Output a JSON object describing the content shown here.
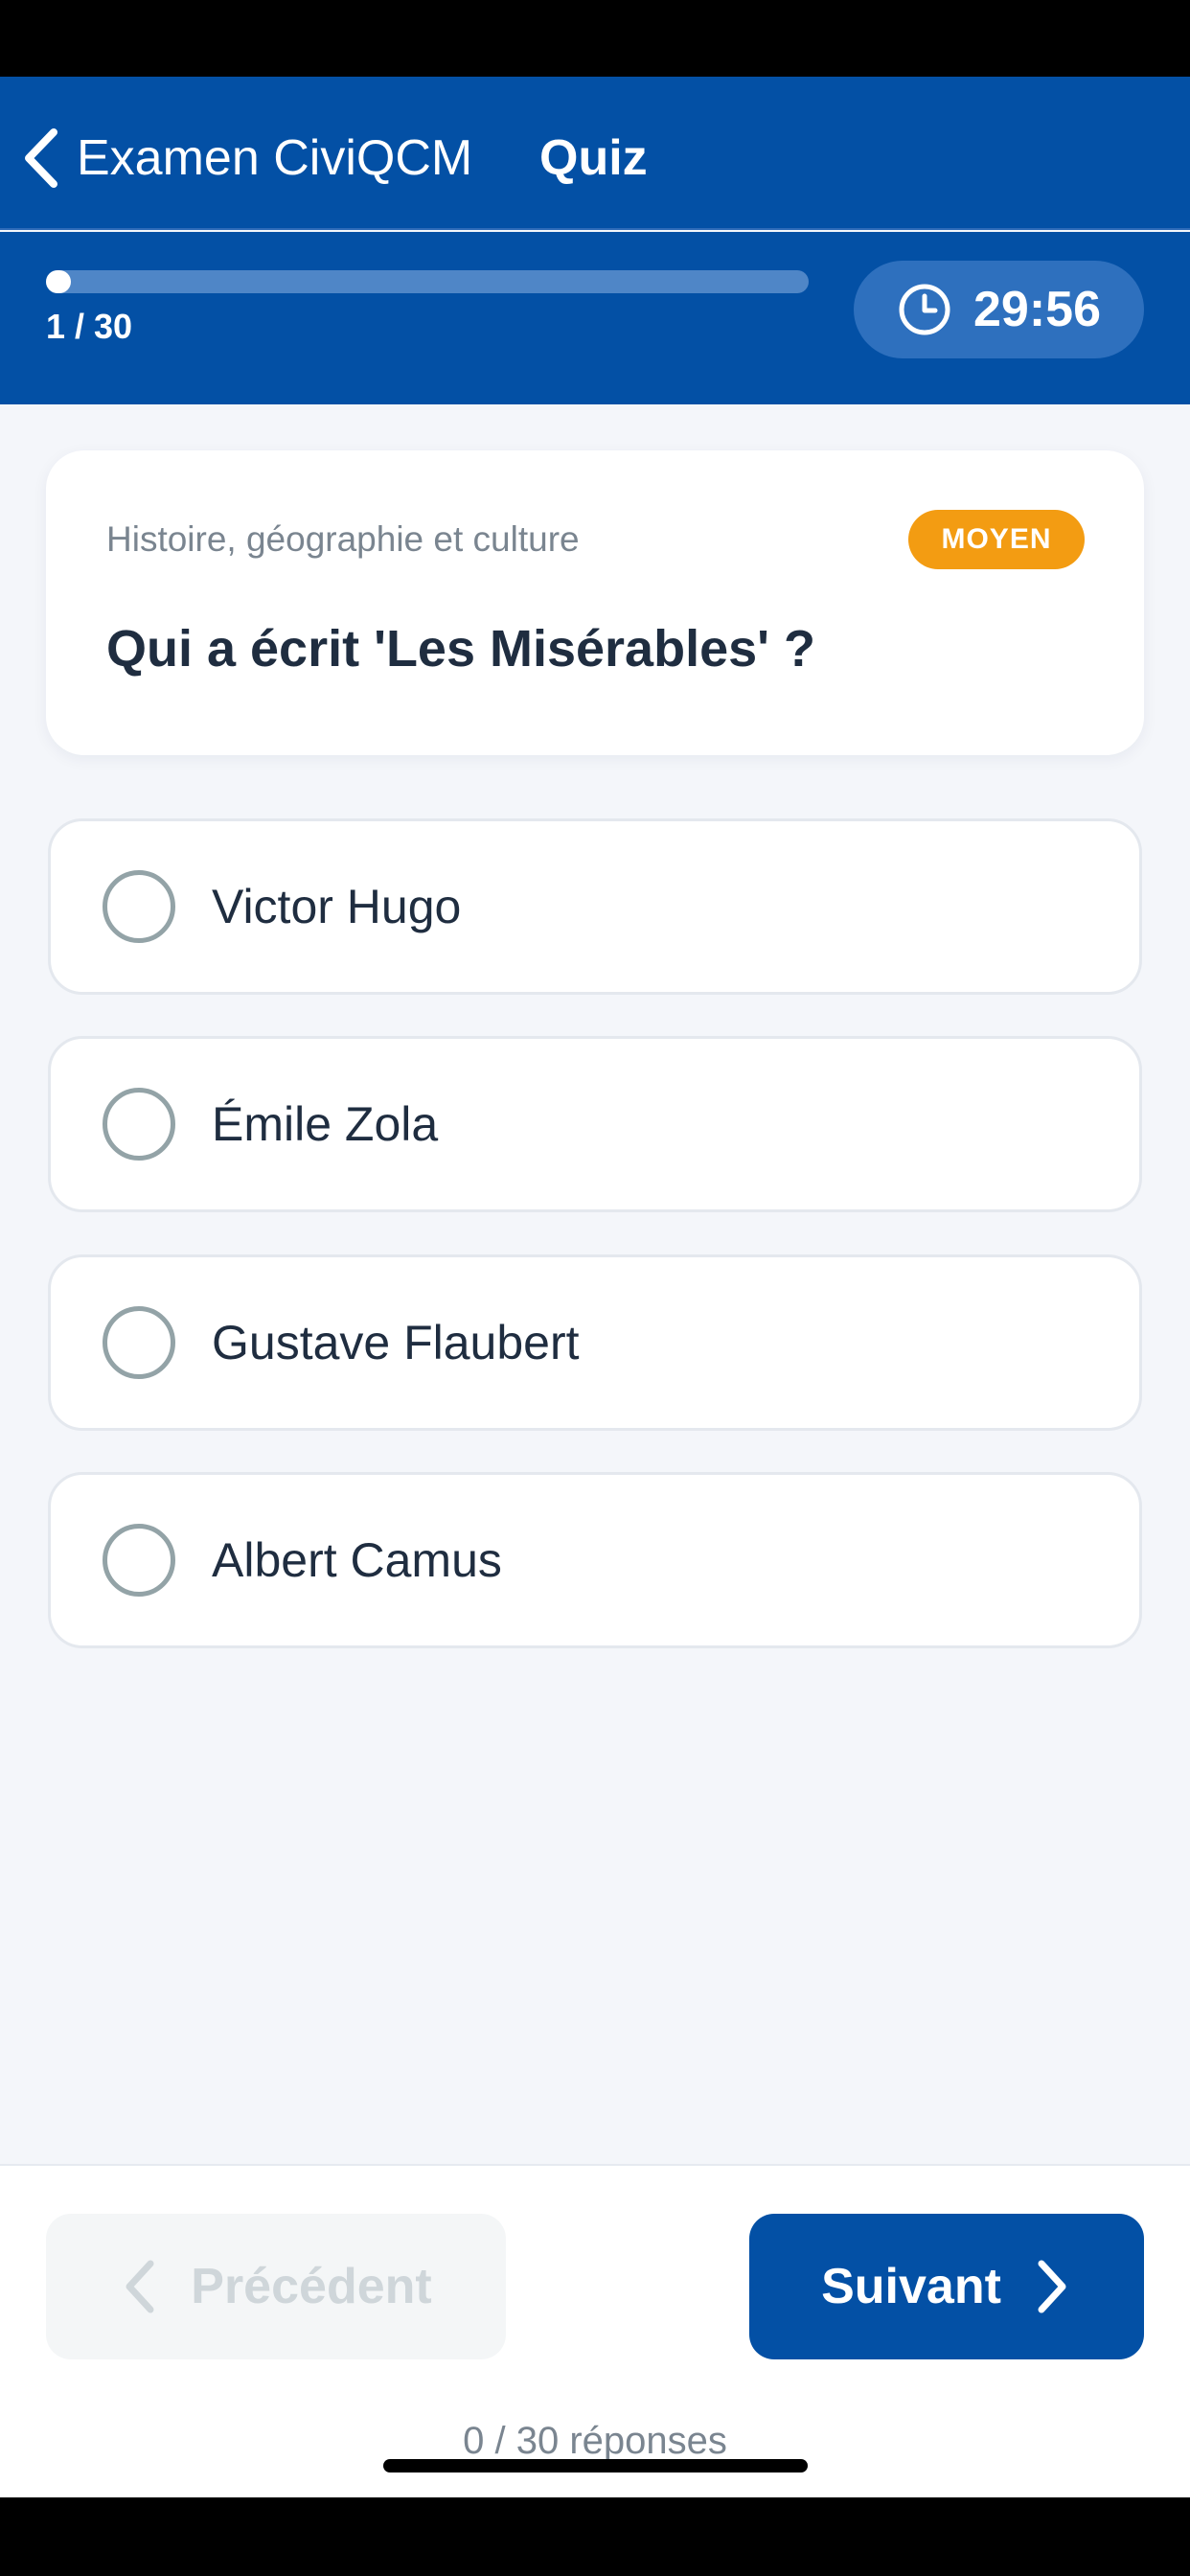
{
  "header": {
    "back_label": "Examen CiviQCM",
    "title": "Quiz"
  },
  "progress": {
    "current": 1,
    "total": 30,
    "fraction": 0.033,
    "label": "1 / 30"
  },
  "timer": {
    "value": "29:56",
    "icon": "clock-icon"
  },
  "question": {
    "category": "Histoire, géographie et culture",
    "difficulty": "MOYEN",
    "text": "Qui a écrit 'Les Misérables' ?"
  },
  "answers": [
    {
      "label": "Victor Hugo",
      "selected": false
    },
    {
      "label": "Émile Zola",
      "selected": false
    },
    {
      "label": "Gustave Flaubert",
      "selected": false
    },
    {
      "label": "Albert Camus",
      "selected": false
    }
  ],
  "navigation": {
    "prev_label": "Précédent",
    "next_label": "Suivant",
    "answers_count": "0 / 30 réponses"
  },
  "colors": {
    "primary": "#0350A5",
    "difficulty_badge": "#F39C12",
    "background": "#F4F6FA"
  }
}
